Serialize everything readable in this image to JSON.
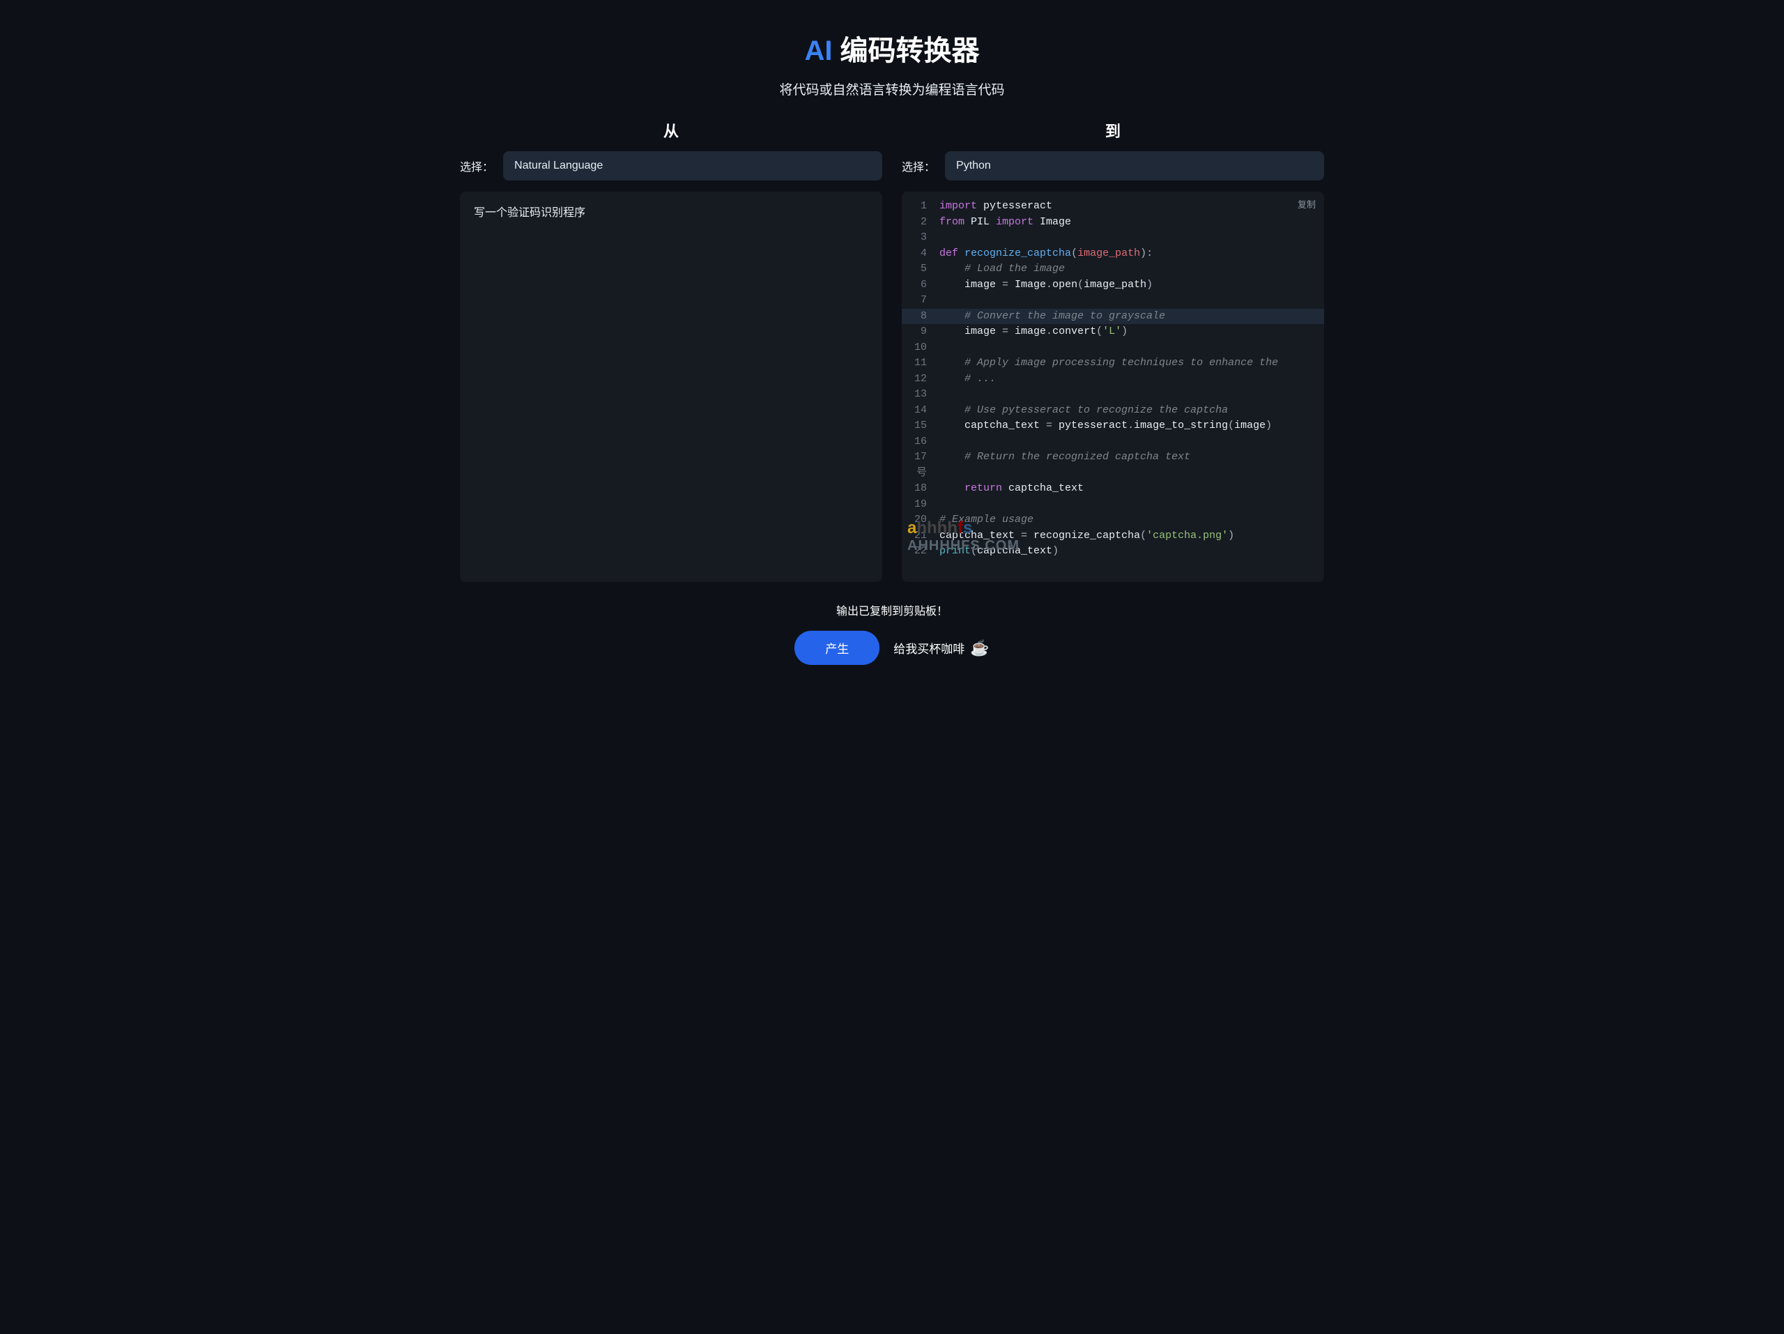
{
  "header": {
    "title_ai": "AI",
    "title_rest": " 编码转换器",
    "subtitle": "将代码或自然语言转换为编程语言代码"
  },
  "panel_from": {
    "heading": "从",
    "select_label": "选择：",
    "select_value": "Natural Language",
    "input_text": "写一个验证码识别程序"
  },
  "panel_to": {
    "heading": "到",
    "select_label": "选择：",
    "select_value": "Python",
    "copy_label": "复制",
    "code_lines": [
      {
        "num": "1",
        "highlighted": false,
        "tokens": [
          [
            "keyword",
            "import"
          ],
          [
            "name",
            " pytesseract"
          ]
        ]
      },
      {
        "num": "2",
        "highlighted": false,
        "tokens": [
          [
            "keyword",
            "from"
          ],
          [
            "name",
            " PIL "
          ],
          [
            "keyword",
            "import"
          ],
          [
            "name",
            " Image"
          ]
        ]
      },
      {
        "num": "3",
        "highlighted": false,
        "tokens": []
      },
      {
        "num": "4",
        "highlighted": false,
        "tokens": [
          [
            "keyword",
            "def"
          ],
          [
            "name",
            " "
          ],
          [
            "def",
            "recognize_captcha"
          ],
          [
            "punct",
            "("
          ],
          [
            "param",
            "image_path"
          ],
          [
            "punct",
            "):"
          ]
        ]
      },
      {
        "num": "5",
        "highlighted": false,
        "tokens": [
          [
            "name",
            "    "
          ],
          [
            "comment",
            "# Load the image"
          ]
        ]
      },
      {
        "num": "6",
        "highlighted": false,
        "tokens": [
          [
            "name",
            "    image "
          ],
          [
            "punct",
            "="
          ],
          [
            "name",
            " Image"
          ],
          [
            "punct",
            "."
          ],
          [
            "name",
            "open"
          ],
          [
            "punct",
            "("
          ],
          [
            "name",
            "image_path"
          ],
          [
            "punct",
            ")"
          ]
        ]
      },
      {
        "num": "7",
        "highlighted": false,
        "tokens": []
      },
      {
        "num": "8",
        "highlighted": true,
        "tokens": [
          [
            "name",
            "    "
          ],
          [
            "comment",
            "# Convert the image to grayscale"
          ]
        ]
      },
      {
        "num": "9",
        "highlighted": false,
        "tokens": [
          [
            "name",
            "    image "
          ],
          [
            "punct",
            "="
          ],
          [
            "name",
            " image"
          ],
          [
            "punct",
            "."
          ],
          [
            "name",
            "convert"
          ],
          [
            "punct",
            "("
          ],
          [
            "string",
            "'L'"
          ],
          [
            "punct",
            ")"
          ]
        ]
      },
      {
        "num": "10",
        "highlighted": false,
        "tokens": []
      },
      {
        "num": "11",
        "highlighted": false,
        "tokens": [
          [
            "name",
            "    "
          ],
          [
            "comment",
            "# Apply image processing techniques to enhance the"
          ]
        ]
      },
      {
        "num": "12",
        "highlighted": false,
        "tokens": [
          [
            "name",
            "    "
          ],
          [
            "comment",
            "# ..."
          ]
        ]
      },
      {
        "num": "13",
        "highlighted": false,
        "tokens": []
      },
      {
        "num": "14",
        "highlighted": false,
        "tokens": [
          [
            "name",
            "    "
          ],
          [
            "comment",
            "# Use pytesseract to recognize the captcha"
          ]
        ]
      },
      {
        "num": "15",
        "highlighted": false,
        "tokens": [
          [
            "name",
            "    captcha_text "
          ],
          [
            "punct",
            "="
          ],
          [
            "name",
            " pytesseract"
          ],
          [
            "punct",
            "."
          ],
          [
            "name",
            "image_to_string"
          ],
          [
            "punct",
            "("
          ],
          [
            "name",
            "image"
          ],
          [
            "punct",
            ")"
          ]
        ]
      },
      {
        "num": "16",
        "highlighted": false,
        "tokens": []
      },
      {
        "num": "17 号",
        "highlighted": false,
        "tokens": [
          [
            "name",
            "    "
          ],
          [
            "comment",
            "# Return the recognized captcha text"
          ]
        ]
      },
      {
        "num": "18",
        "highlighted": false,
        "tokens": [
          [
            "name",
            "    "
          ],
          [
            "keyword",
            "return"
          ],
          [
            "name",
            " captcha_text"
          ]
        ]
      },
      {
        "num": "19",
        "highlighted": false,
        "tokens": []
      },
      {
        "num": "20",
        "highlighted": false,
        "tokens": [
          [
            "comment",
            "# Example usage"
          ]
        ]
      },
      {
        "num": "21",
        "highlighted": false,
        "tokens": [
          [
            "name",
            "captcha_text "
          ],
          [
            "punct",
            "="
          ],
          [
            "name",
            " recognize_captcha"
          ],
          [
            "punct",
            "("
          ],
          [
            "string",
            "'captcha.png'"
          ],
          [
            "punct",
            ")"
          ]
        ]
      },
      {
        "num": "22",
        "highlighted": false,
        "tokens": [
          [
            "builtin",
            "print"
          ],
          [
            "punct",
            "("
          ],
          [
            "name",
            "captcha_text"
          ],
          [
            "punct",
            ")"
          ]
        ]
      }
    ]
  },
  "watermark": {
    "line1_parts": [
      "a",
      "hhhh",
      "f",
      "s"
    ],
    "line2": "AHHHHFS.COM"
  },
  "footer": {
    "status": "输出已复制到剪贴板！",
    "generate_label": "产生",
    "coffee_label": "给我买杯咖啡"
  }
}
